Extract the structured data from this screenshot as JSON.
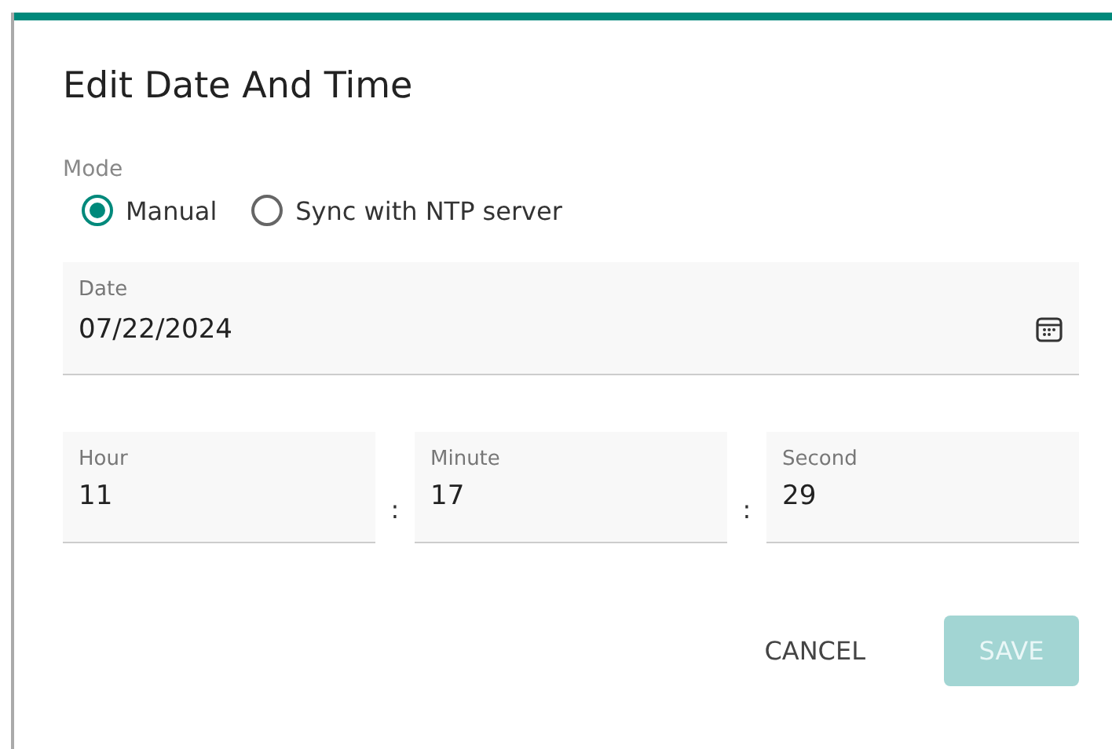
{
  "dialog": {
    "title": "Edit Date And Time"
  },
  "mode": {
    "label": "Mode",
    "options": [
      {
        "label": "Manual",
        "selected": true
      },
      {
        "label": "Sync with NTP server",
        "selected": false
      }
    ]
  },
  "date": {
    "label": "Date",
    "value": "07/22/2024"
  },
  "time": {
    "fields": [
      {
        "label": "Hour",
        "value": "11"
      },
      {
        "label": "Minute",
        "value": "17"
      },
      {
        "label": "Second",
        "value": "29"
      }
    ],
    "separator": ":"
  },
  "buttons": [
    {
      "label": "CANCEL",
      "kind": "text",
      "disabled": false
    },
    {
      "label": "SAVE",
      "kind": "primary",
      "disabled": true
    }
  ]
}
